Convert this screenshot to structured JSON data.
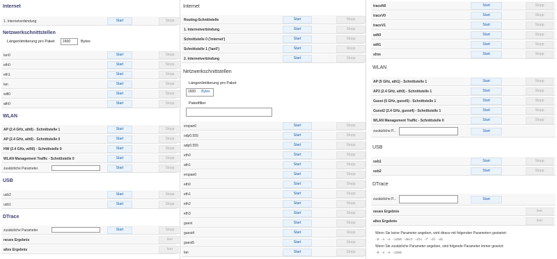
{
  "common": {
    "start": "Start",
    "stop": "Stopp",
    "view": "leer"
  },
  "col1": {
    "internet_title": "Internet",
    "internet_rows": [
      {
        "label": "1. Internetverbindung"
      }
    ],
    "netif_title": "Netzwerkschnittstellen",
    "packet_limit_label": "Längenlimitierung pro Paket",
    "packet_limit_value": "1600",
    "packet_limit_unit": "Bytes",
    "netif_rows": [
      {
        "label": "tun0"
      },
      {
        "label": "eth0"
      },
      {
        "label": "eth1"
      },
      {
        "label": "lan"
      },
      {
        "label": "wifi0"
      },
      {
        "label": "ath0"
      }
    ],
    "wlan_title": "WLAN",
    "wlan_rows": [
      {
        "label": "AP (2.4 GHz, ath0) - Schnittstelle 1"
      },
      {
        "label": "AP (2.4 GHz, ath0) - Schnittstelle 0"
      },
      {
        "label": "HW (2.4 GHz, wifi0) - Schnittstelle 0"
      },
      {
        "label": "WLAN Management Traffic - Schnittstelle 0"
      },
      {
        "label": "zusätzliche Parameter"
      }
    ],
    "usb_title": "USB",
    "usb_rows": [
      {
        "label": "usb2"
      },
      {
        "label": "usb1"
      }
    ],
    "dtrace_title": "DTrace",
    "dtrace_param_label": "zusätzliche Parameter",
    "dtrace_new_result": "neues Ergebnis",
    "dtrace_old_result": "altes Ergebnis"
  },
  "col2": {
    "internet_title": "Internet",
    "internet_rows": [
      {
        "label": "Routing-Schnittstelle"
      },
      {
        "label": "1. Internetverbindung"
      },
      {
        "label": "Schnittstelle 0 ('internet')"
      },
      {
        "label": "Schnittstelle 1 ('lan0')"
      },
      {
        "label": "2. Internetverbindung"
      }
    ],
    "netif_title": "Netzwerkschnittstellen",
    "packet_limit_label": "Längenlimitierung pro Paket",
    "packet_limit_value": "1600",
    "packet_limit_unit": "Bytes",
    "packet_filter_label": "Paketfilter",
    "netif_rows": [
      {
        "label": "erspan0"
      },
      {
        "label": "odp0.555"
      },
      {
        "label": "adp0.555"
      },
      {
        "label": "eth0"
      },
      {
        "label": "ath1"
      },
      {
        "label": "erspan0"
      },
      {
        "label": "eth0"
      },
      {
        "label": "eth1"
      },
      {
        "label": "eth2"
      },
      {
        "label": "eth3"
      },
      {
        "label": "guest"
      },
      {
        "label": "guest4"
      },
      {
        "label": "guest5"
      },
      {
        "label": "lan"
      }
    ]
  },
  "col3": {
    "top_rows": [
      {
        "label": "traceN0"
      },
      {
        "label": "traceV0"
      },
      {
        "label": "traceV1"
      },
      {
        "label": "wifi0"
      },
      {
        "label": "wifi1"
      },
      {
        "label": "xfrm"
      }
    ],
    "wlan_title": "WLAN",
    "wlan_rows": [
      {
        "label": "AP (5 GHz, ath1) - Schnittstelle 1"
      },
      {
        "label": "AP2 (2.4 GHz, ath0) - Schnittstelle 1"
      },
      {
        "label": "Guest (5 GHz, guest5) - Schnittstelle 1"
      },
      {
        "label": "Guest2 (2.4 GHz, guest4) - Schnittstelle 1"
      },
      {
        "label": "WLAN Management Traffic - Schnittstelle 0"
      },
      {
        "label": "zusätzliche P..."
      }
    ],
    "usb_title": "USB",
    "usb_rows": [
      {
        "label": "usb1"
      },
      {
        "label": "usb2"
      }
    ],
    "dtrace_title": "DTrace",
    "dtrace_param_label": "zusätzliche P...",
    "dtrace_new_result": "neues Ergebnis",
    "dtrace_old_result": "altes Ergebnis",
    "note1": "Wenn Sie keine Parameter angeben, wird dtrace mit folgenden Parametern gestartet:",
    "note1_code": "-D -s -e -i256 -dect -dlc -f -dl -di",
    "note2": "Wenn Sie zusätzliche Parameter angeben, sind folgende Parameter immer gesetzt:",
    "note2_code": "-D -s -e -i256"
  }
}
